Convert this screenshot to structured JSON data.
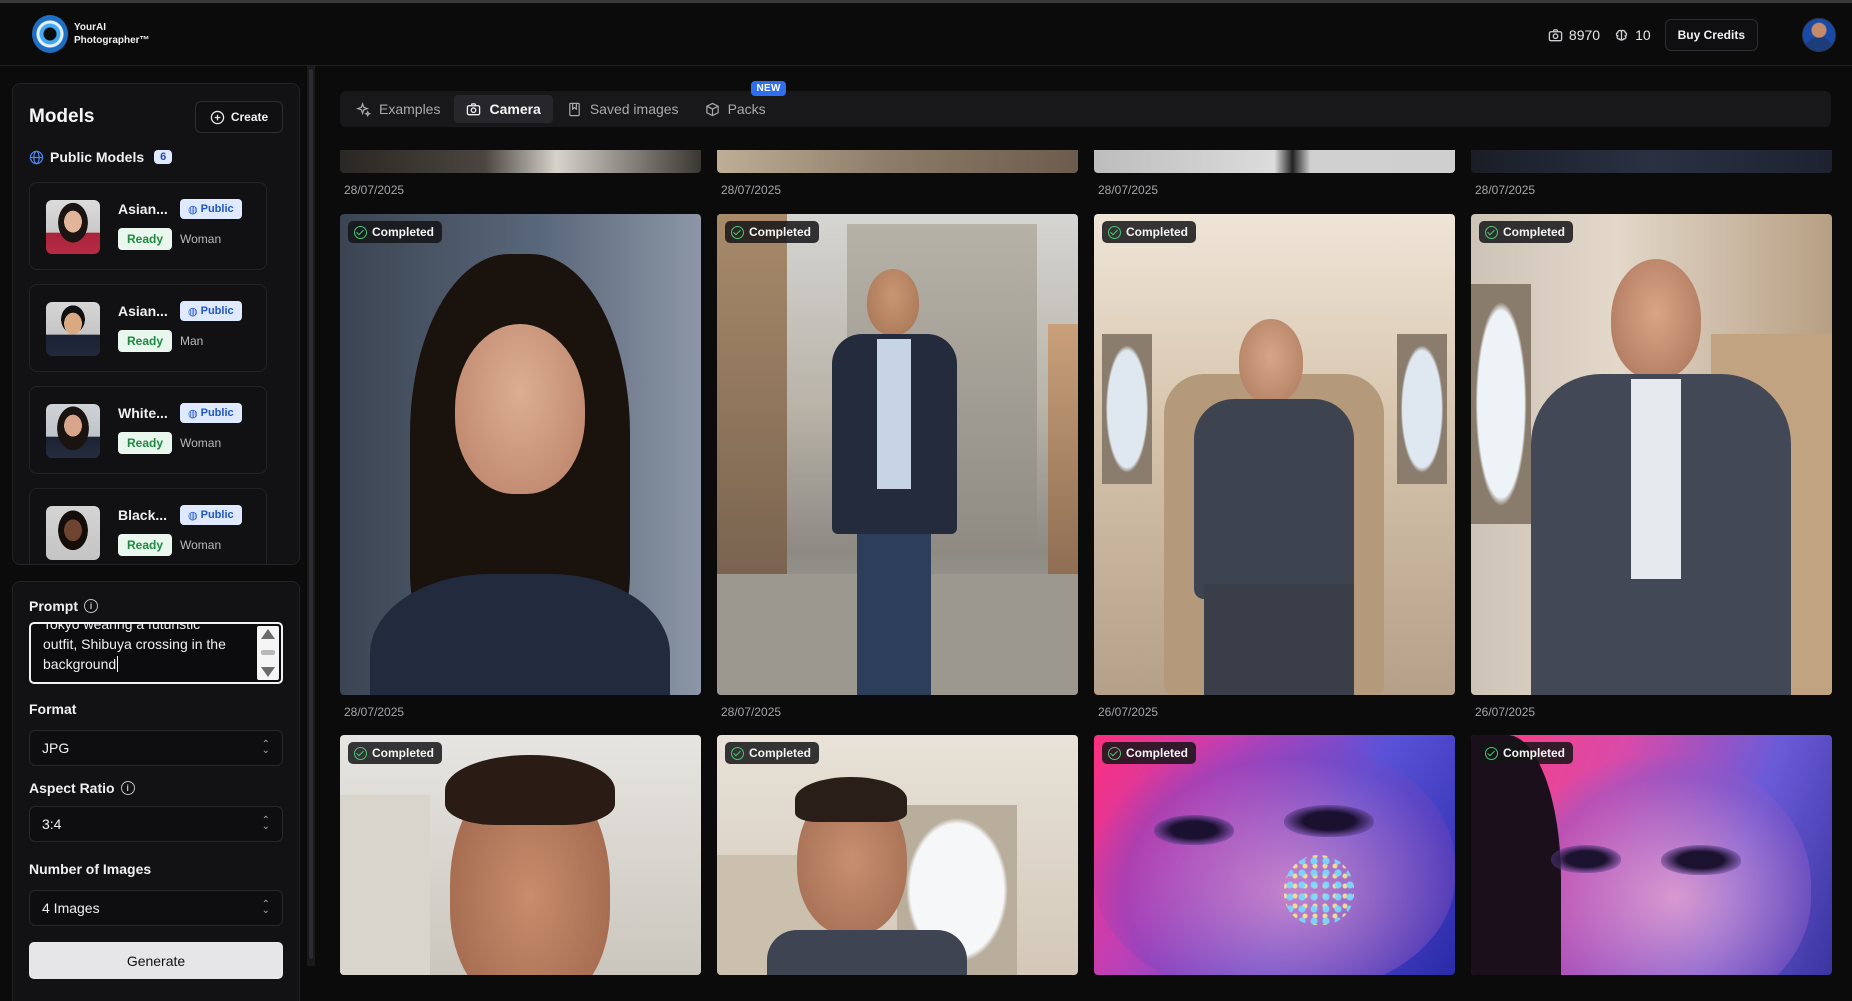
{
  "header": {
    "brand_line1": "YourAI",
    "brand_line2": "Photographer™",
    "photo_credits": "8970",
    "model_credits": "10",
    "buy_label": "Buy Credits"
  },
  "models": {
    "title": "Models",
    "create_label": "Create",
    "public_heading": "Public Models",
    "public_count": "6",
    "items": [
      {
        "name": "Asian...",
        "badge": "Public",
        "status": "Ready",
        "gender": "Woman"
      },
      {
        "name": "Asian...",
        "badge": "Public",
        "status": "Ready",
        "gender": "Man"
      },
      {
        "name": "White...",
        "badge": "Public",
        "status": "Ready",
        "gender": "Woman"
      },
      {
        "name": "Black...",
        "badge": "Public",
        "status": "Ready",
        "gender": "Woman"
      }
    ]
  },
  "form": {
    "prompt_label": "Prompt",
    "prompt_line1": "Tokyo wearing a futuristic",
    "prompt_line2": "outfit, Shibuya crossing in the",
    "prompt_line3": "background",
    "format_label": "Format",
    "format_value": "JPG",
    "aspect_label": "Aspect Ratio",
    "aspect_value": "3:4",
    "count_label": "Number of Images",
    "count_value": "4 Images",
    "generate_label": "Generate"
  },
  "tabs": [
    {
      "label": "Examples"
    },
    {
      "label": "Camera"
    },
    {
      "label": "Saved images"
    },
    {
      "label": "Packs",
      "badge": "NEW"
    }
  ],
  "gallery": {
    "status_label": "Completed",
    "top_dates": [
      "28/07/2025",
      "28/07/2025",
      "28/07/2025",
      "28/07/2025"
    ],
    "row1_dates": [
      "28/07/2025",
      "28/07/2025",
      "26/07/2025",
      "26/07/2025"
    ]
  }
}
